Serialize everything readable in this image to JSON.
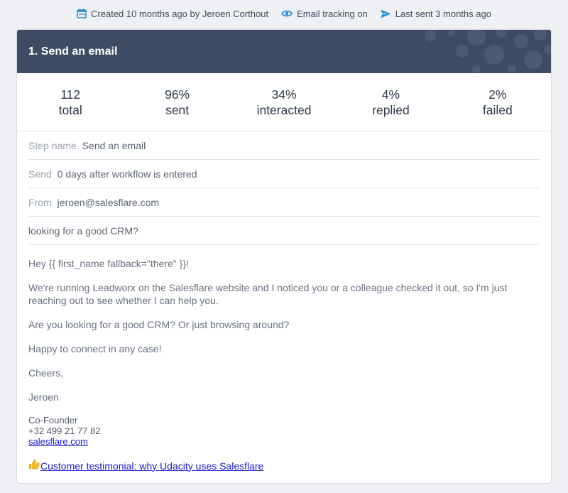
{
  "meta": {
    "created": "Created 10 months ago by Jeroen Corthout",
    "tracking": "Email tracking on",
    "last_sent": "Last sent 3 months ago"
  },
  "step": {
    "title": "1. Send an email"
  },
  "stats": [
    {
      "value": "112",
      "label": "total"
    },
    {
      "value": "96%",
      "label": "sent"
    },
    {
      "value": "34%",
      "label": "interacted"
    },
    {
      "value": "4%",
      "label": "replied"
    },
    {
      "value": "2%",
      "label": "failed"
    }
  ],
  "fields": {
    "step_name_label": "Step name",
    "step_name_value": "Send an email",
    "send_label": "Send",
    "send_value": "0 days after workflow is entered",
    "from_label": "From",
    "from_value": "jeroen@salesflare.com",
    "subject": "looking for a good CRM?"
  },
  "body": {
    "greeting": "Hey {{ first_name fallback=\"there\" }}!",
    "p1": "We're running Leadworx on the Salesflare website and I noticed you or a colleague checked it out, so I'm just reaching out to see whether I can help you.",
    "p2": "Are you looking for a good CRM? Or just browsing around?",
    "p3": "Happy to connect in any case!",
    "p4": "Cheers,",
    "p5": "Jeroen"
  },
  "signature": {
    "role": "Co-Founder",
    "phone": "+32 499 21 77 82",
    "link": "salesflare.com"
  },
  "testimonial": {
    "link_text": " Customer testimonial: why Udacity uses Salesflare"
  },
  "colors": {
    "header_bg": "#3d4c63",
    "accent_blue": "#2b8fd6",
    "link": "#1a1ad6"
  },
  "icons": [
    "calendar-icon",
    "eye-icon",
    "send-icon",
    "thumbs-up-icon"
  ]
}
